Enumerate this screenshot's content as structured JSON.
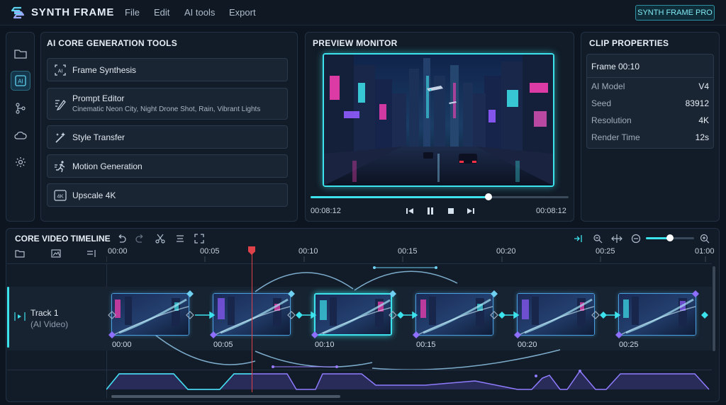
{
  "app": {
    "title": "SYNTH FRAME",
    "badge": "SYNTH FRAME PRO"
  },
  "menu": [
    "File",
    "Edit",
    "AI tools",
    "Export"
  ],
  "rail": [
    "folder-icon",
    "ai-icon",
    "branch-icon",
    "cloud-icon",
    "gear-icon"
  ],
  "ai_tools": {
    "title": "AI CORE GENERATION TOOLS",
    "items": [
      {
        "label": "Frame Synthesis",
        "icon": "ai-frame-icon"
      },
      {
        "label": "Prompt Editor",
        "sub": "Cinematic Neon City, Night Drone Shot, Rain, Vibrant Lights",
        "icon": "pen-icon"
      },
      {
        "label": "Style Transfer",
        "icon": "magic-wand-icon"
      },
      {
        "label": "Motion Generation",
        "icon": "running-icon"
      },
      {
        "label": "Upscale 4K",
        "icon": "4k-icon",
        "icon_text": "4K"
      }
    ]
  },
  "preview": {
    "title": "PREVIEW MONITOR",
    "time_left": "00:08:12",
    "time_right": "00:08:12",
    "progress": 0.69
  },
  "clip_props": {
    "title": "CLIP PROPERTIES",
    "header": "Frame 00:10",
    "rows": [
      {
        "label": "AI Model",
        "value": "V4"
      },
      {
        "label": "Seed",
        "value": "83912"
      },
      {
        "label": "Resolution",
        "value": "4K"
      },
      {
        "label": "Render Time",
        "value": "12s"
      }
    ]
  },
  "timeline": {
    "title": "CORE VIDEO TIMELINE",
    "ruler": [
      "00:00",
      "00:05",
      "00:10",
      "00:15",
      "00:20",
      "00:25",
      "01:00"
    ],
    "track": {
      "name": "Track 1",
      "sub": "(AI Video)"
    },
    "clips": [
      "00:00",
      "00:05",
      "00:10",
      "00:15",
      "00:20",
      "00:25"
    ],
    "selected_clip": 2,
    "zoom": 0.5
  },
  "colors": {
    "accent": "#3de3ec",
    "playhead": "#e0424a",
    "panel": "#121c28",
    "bg": "#0d1520"
  }
}
